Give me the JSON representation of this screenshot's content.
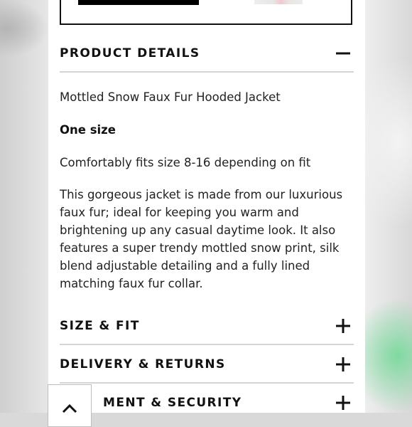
{
  "product_details": {
    "title": "PRODUCT DETAILS",
    "toggle_icon": "minus-icon",
    "name": "Mottled Snow Faux Fur Hooded Jacket",
    "size_label": "One size",
    "fit_note": "Comfortably fits size 8-16 depending on fit",
    "description": "This gorgeous jacket is made from our luxurious faux fur; ideal for keeping you warm and brightening up any casual daytime look. It also features a super trendy mottled snow print, silk blend adjustable detailing and a fully lined matching faux fur collar."
  },
  "sections": [
    {
      "title": "SIZE & FIT",
      "icon": "plus-icon"
    },
    {
      "title": "DELIVERY & RETURNS",
      "icon": "plus-icon"
    },
    {
      "title": "MENT & SECURITY",
      "icon": "plus-icon"
    }
  ],
  "back_to_top": {
    "icon": "chevron-up-icon"
  }
}
